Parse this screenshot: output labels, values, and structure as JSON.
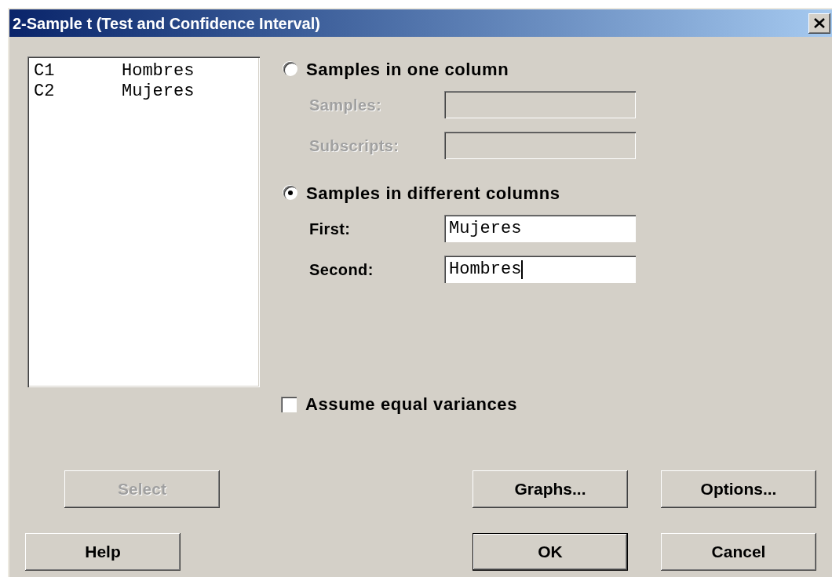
{
  "window": {
    "title": "2-Sample t (Test and Confidence Interval)"
  },
  "variables": [
    {
      "column": "C1",
      "name": "Hombres"
    },
    {
      "column": "C2",
      "name": "Mujeres"
    }
  ],
  "sample_modes": [
    {
      "label": "Samples in one column",
      "selected": false,
      "fields": [
        {
          "label": "Samples:",
          "disabled": true
        },
        {
          "label": "Subscripts:",
          "disabled": true
        }
      ]
    },
    {
      "label": "Samples in different columns",
      "selected": true,
      "fields": [
        {
          "label": "First:",
          "value": "Mujeres",
          "disabled": false,
          "focused": false
        },
        {
          "label": "Second:",
          "value": "Hombres",
          "disabled": false,
          "focused": true
        }
      ]
    }
  ],
  "equal_variances": {
    "label": "Assume equal variances",
    "checked": false
  },
  "button_rows": [
    [
      {
        "label": "Select",
        "disabled": true
      },
      {
        "label": "Graphs...",
        "disabled": false
      },
      {
        "label": "Options...",
        "disabled": false
      }
    ],
    [
      {
        "label": "Help",
        "disabled": false
      },
      {
        "label": "OK",
        "disabled": false,
        "default": true
      },
      {
        "label": "Cancel",
        "disabled": false
      }
    ]
  ]
}
